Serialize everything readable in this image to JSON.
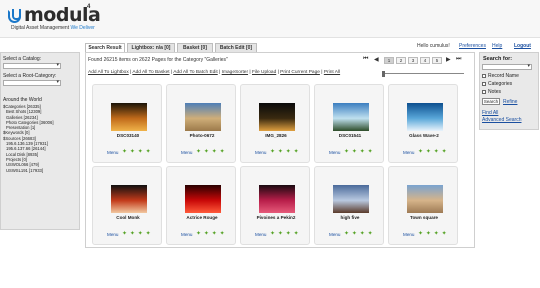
{
  "header": {
    "logo": "modula",
    "logo_sup": "4",
    "tagline_prefix": "Digital Asset Management",
    "tagline_suffix": "We Deliver"
  },
  "sidebar": {
    "catalog_label": "Select a Catalog:",
    "root_label": "Select a Root-Category:",
    "section_label": "Around the World",
    "tree": [
      {
        "level": 0,
        "text": "$Categories [26335]"
      },
      {
        "level": 1,
        "text": "Best Shots [12309]"
      },
      {
        "level": 1,
        "text": "Galleries [26234]"
      },
      {
        "level": 1,
        "text": "Photo Categories [36006]"
      },
      {
        "level": 1,
        "text": "Presentation [1]"
      },
      {
        "level": 0,
        "text": "$Keywords [0]"
      },
      {
        "level": 0,
        "text": "$Sources [26683]"
      },
      {
        "level": 1,
        "text": "195.6.136.139 [17931]"
      },
      {
        "level": 1,
        "text": "195.6.137.66 [26144]"
      },
      {
        "level": 1,
        "text": "Local Disk [8935]"
      },
      {
        "level": 1,
        "text": "Projects [0]"
      },
      {
        "level": 1,
        "text": "USWOL066 [479]"
      },
      {
        "level": 1,
        "text": "USWSL191 [17933]"
      }
    ]
  },
  "tabs": [
    {
      "label": "Search Result"
    },
    {
      "label": "Lightbox: n/a [0]"
    },
    {
      "label": "Basket [0]"
    },
    {
      "label": "Batch Edit [0]"
    }
  ],
  "top_links": {
    "greeting": "Hello cumulus!",
    "preferences": "Preferences",
    "help": "Help",
    "logout": "Logout"
  },
  "main": {
    "found_text": "Found 26215 items on 2622 Pages for the Category \"Galleries\"",
    "pages": [
      "1",
      "2",
      "3",
      "4",
      "5"
    ],
    "current_page": "1",
    "actions": [
      "Add All To Lightbox",
      "Add All To Basket",
      "Add All To Batch Edit",
      "ImageSorter",
      "File Upload",
      "Print Current Page",
      "Print All"
    ]
  },
  "cards": [
    {
      "name": "DSC03140",
      "colors": [
        "#1b1408",
        "#c06a1a",
        "#f0b34a"
      ]
    },
    {
      "name": "Photo-0672",
      "colors": [
        "#4e7fb7",
        "#cfae79",
        "#9c7a4a"
      ]
    },
    {
      "name": "IMG_2826",
      "colors": [
        "#0a0a0a",
        "#3a2a10",
        "#e0a040"
      ]
    },
    {
      "name": "DSC01541",
      "colors": [
        "#3b7ec0",
        "#bfe0ef",
        "#2d4c28"
      ]
    },
    {
      "name": "Glass Wave-2",
      "colors": [
        "#0d4f8f",
        "#59a7d9",
        "#e9f3fb"
      ]
    },
    {
      "name": "Cool Monk",
      "colors": [
        "#101010",
        "#c23a1a",
        "#f2c8a0"
      ]
    },
    {
      "name": "Actrice Rouge",
      "colors": [
        "#2a0000",
        "#c80808",
        "#ff5a3a"
      ]
    },
    {
      "name": "Pivoines a Pekin2",
      "colors": [
        "#1a0a10",
        "#b81e4a",
        "#e65a7a"
      ]
    },
    {
      "name": "high five",
      "colors": [
        "#4a6a9a",
        "#b9c9e0",
        "#5a3a2a"
      ]
    },
    {
      "name": "Town square",
      "colors": [
        "#7aa3d0",
        "#d6b48a",
        "#9e7b55"
      ]
    }
  ],
  "card_menu_label": "Menu",
  "card_icons": "✦ ✦ ✦ ✦",
  "search_panel": {
    "title": "Search for:",
    "options": [
      "Record Name",
      "Categories",
      "Notes"
    ],
    "search_button": "Search",
    "refine": "Refine",
    "find_all": "Find All",
    "advanced": "Advanced Search"
  }
}
